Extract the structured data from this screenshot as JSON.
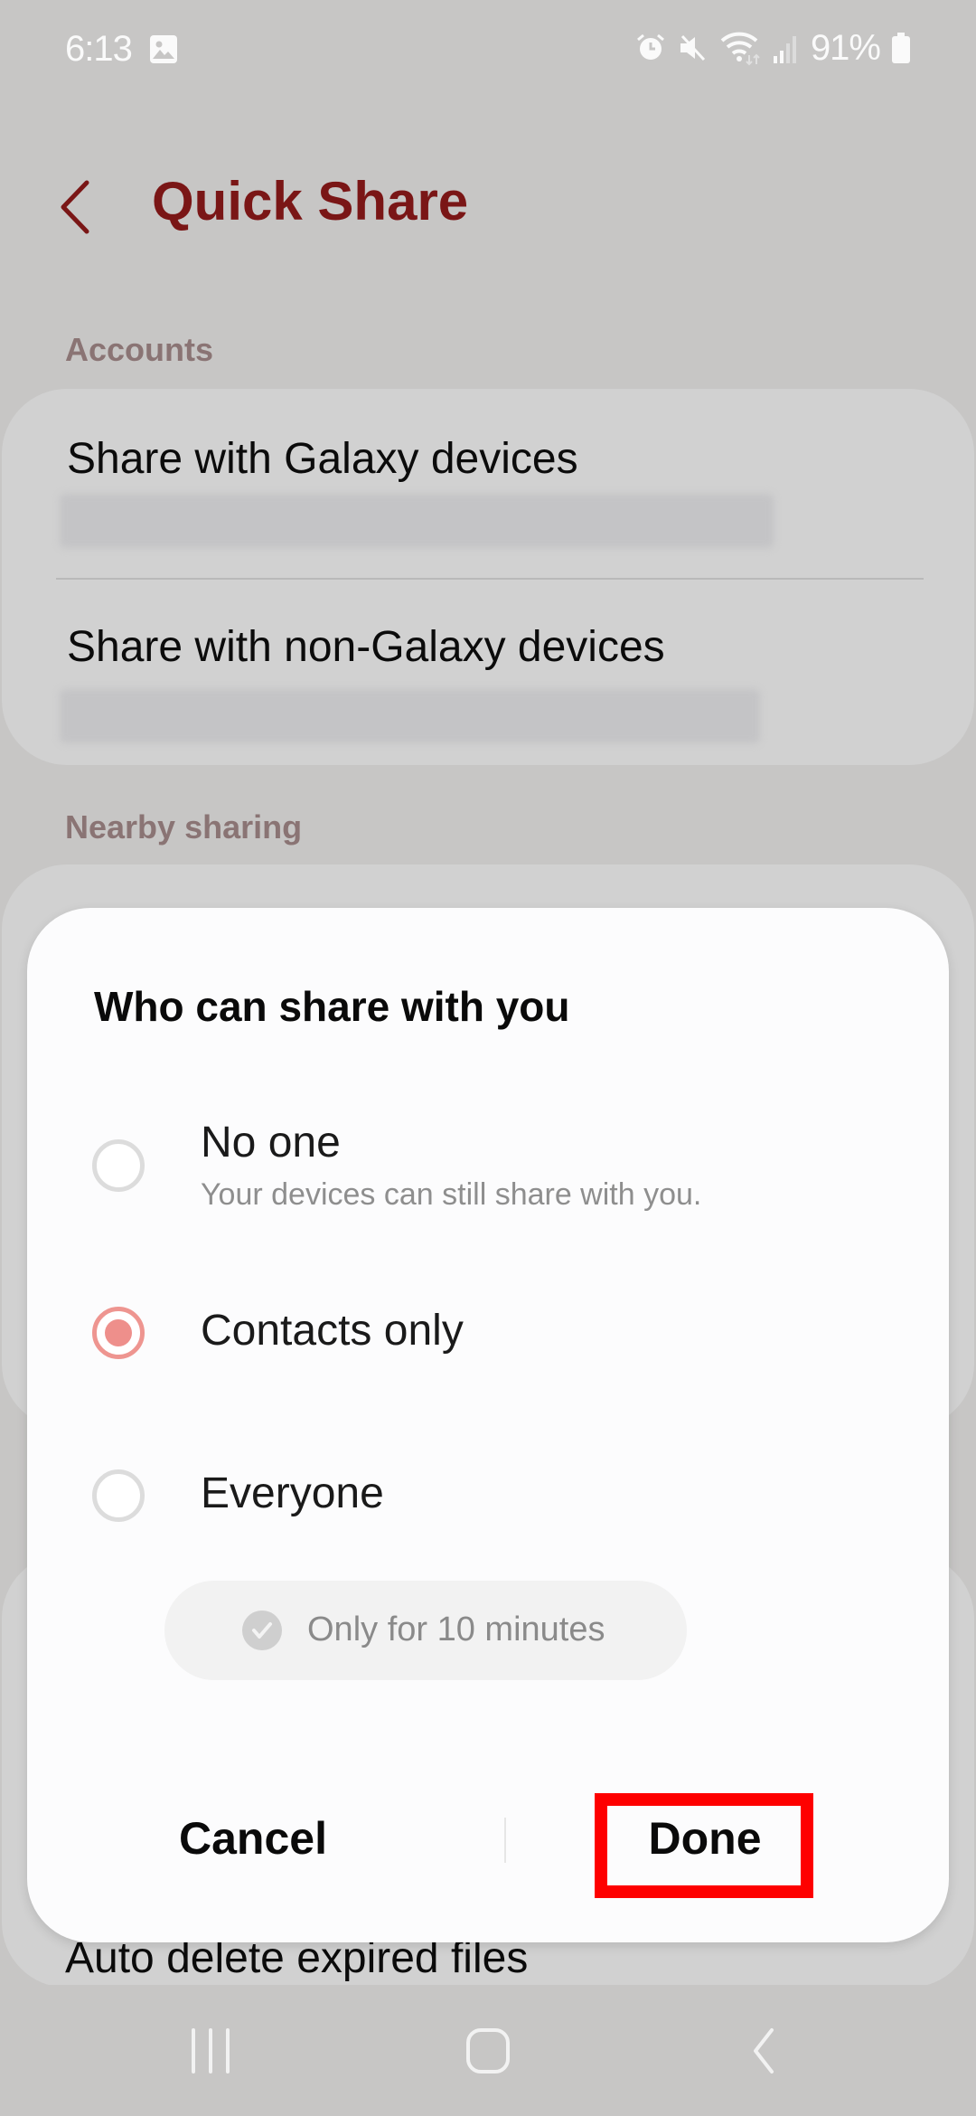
{
  "status_bar": {
    "time": "6:13",
    "notification_icons": [
      "gallery-icon"
    ],
    "system_icons": [
      "alarm-icon",
      "mute-icon",
      "wifi-icon",
      "signal-icon"
    ],
    "battery_percent": "91%"
  },
  "header": {
    "back_icon": "chevron-left-icon",
    "title": "Quick Share"
  },
  "sections": {
    "accounts": {
      "label": "Accounts",
      "items": [
        {
          "title": "Share with Galaxy devices",
          "subtitle_redacted": true
        },
        {
          "title": "Share with non-Galaxy devices",
          "subtitle_redacted": true
        }
      ]
    },
    "nearby": {
      "label": "Nearby sharing"
    },
    "partially_hidden_item": "Auto delete expired files"
  },
  "dialog": {
    "title": "Who can share with you",
    "options": [
      {
        "label": "No one",
        "description": "Your devices can still share with you.",
        "selected": false
      },
      {
        "label": "Contacts only",
        "description": "",
        "selected": true
      },
      {
        "label": "Everyone",
        "description": "",
        "selected": false
      }
    ],
    "timer_option": {
      "label": "Only for 10 minutes",
      "checked": true,
      "enabled": false
    },
    "buttons": {
      "cancel": "Cancel",
      "done": "Done"
    },
    "highlighted_button": "done"
  },
  "colors": {
    "accent": "#7a1616",
    "radio_selected": "#ee8f8b",
    "highlight": "#fe0000"
  },
  "nav_bar": {
    "buttons": [
      "recents-icon",
      "home-icon",
      "back-icon"
    ]
  }
}
